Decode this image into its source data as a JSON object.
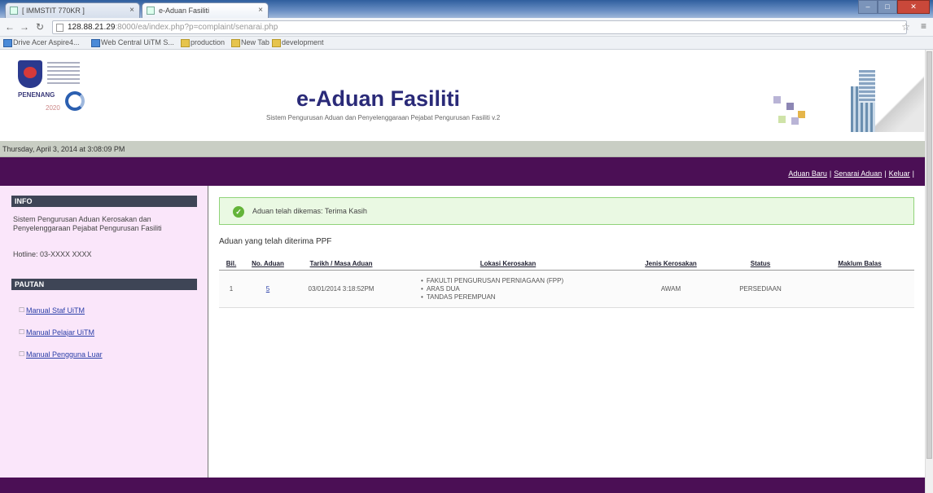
{
  "browser": {
    "tabs": [
      {
        "label": "[ IMMSTIT 770KR ]"
      },
      {
        "label": "e-Aduan Fasiliti"
      }
    ],
    "url_host": "128.88.21.29",
    "url_path": ":8000/ea/index.php?p=complaint/senarai.php",
    "bookmarks": [
      "Drive Acer Aspire4...",
      "Web Central UiTM S...",
      "production",
      "New Tab",
      "development"
    ]
  },
  "header": {
    "title": "e-Aduan Fasiliti",
    "subtitle": "Sistem  Pengurusan Aduan dan Penyelenggaraan Pejabat Pengurusan Fasiliti v.2",
    "logo_text": "PENENANG",
    "logo_year": "2020"
  },
  "datebar": {
    "text": "Thursday, April 3, 2014 at 3:08:09 PM"
  },
  "toplinks": [
    "Aduan Baru",
    "Senarai Aduan",
    "Keluar"
  ],
  "sidebar": {
    "info_head": "INFO",
    "info_text": "Sistem Pengurusan Aduan Kerosakan dan Penyelenggaraan Pejabat Pengurusan Fasiliti",
    "phone": "Hotline: 03-XXXX XXXX",
    "manual_head": "PAUTAN",
    "links": [
      "Manual Staf UiTM",
      "Manual Pelajar UiTM",
      "Manual Pengguna Luar"
    ]
  },
  "main": {
    "alert": "Aduan telah dikemas: Terima Kasih",
    "section_title": "Aduan yang telah diterima PPF",
    "columns": [
      "Bil.",
      "No. Aduan",
      "Tarikh / Masa Aduan",
      "Lokasi Kerosakan",
      "Jenis Kerosakan",
      "Status",
      "Maklum Balas"
    ],
    "rows": [
      {
        "bil": "1",
        "no": "5",
        "tarikh": "03/01/2014 3:18:52PM",
        "lokasi": [
          "FAKULTI PENGURUSAN PERNIAGAAN (FPP)",
          "ARAS DUA",
          "TANDAS PEREMPUAN"
        ],
        "jenis": "AWAM",
        "status": "PERSEDIAAN",
        "maklum": ""
      }
    ]
  },
  "colors": {
    "brand_purple": "#4b0f55",
    "sidebar_bg": "#fae6fa",
    "title": "#2a2a78"
  }
}
